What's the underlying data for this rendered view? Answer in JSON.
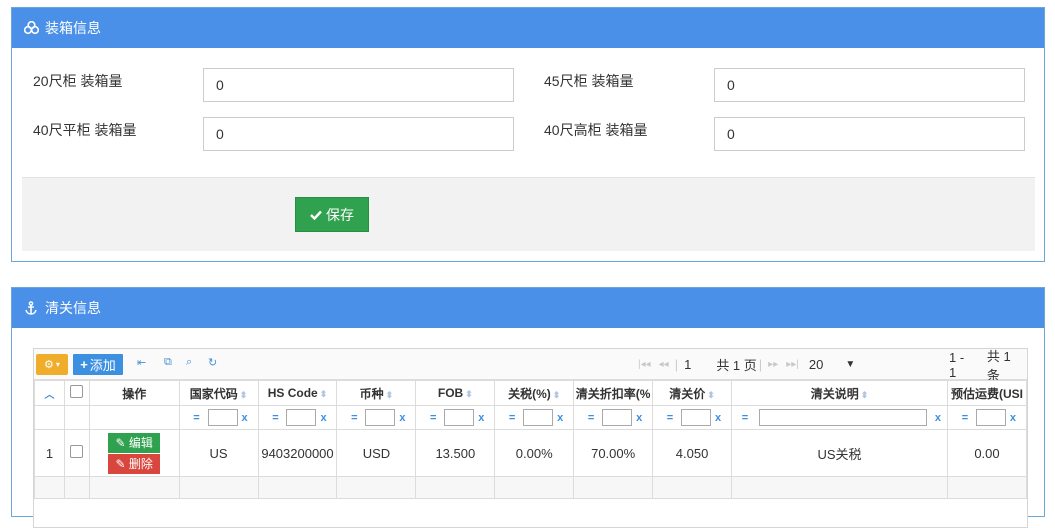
{
  "packing": {
    "title": "装箱信息",
    "icon": "boxes-icon",
    "fields": [
      {
        "label": "20尺柜 装箱量",
        "value": "0"
      },
      {
        "label": "45尺柜 装箱量",
        "value": "0"
      },
      {
        "label": "40尺平柜 装箱量",
        "value": "0"
      },
      {
        "label": "40尺高柜 装箱量",
        "value": "0"
      }
    ],
    "save_label": "保存"
  },
  "customs": {
    "title": "清关信息",
    "icon": "anchor-icon",
    "toolbar": {
      "add_label": "添加",
      "page": "1",
      "total_pages": "共 1 页",
      "page_size": "20",
      "range": "1 - 1",
      "total_rows": "共 1 条"
    },
    "columns": [
      "操作",
      "国家代码",
      "HS Code",
      "币种",
      "FOB",
      "关税(%)",
      "清关折扣率(%",
      "清关价",
      "清关说明",
      "预估运费(USI"
    ],
    "filter_eq": "=",
    "filter_clear": "x",
    "rows": [
      {
        "index": "1",
        "edit_label": "编辑",
        "delete_label": "删除",
        "country": "US",
        "hs_code": "9403200000",
        "currency": "USD",
        "fob": "13.500",
        "duty": "0.00%",
        "discount": "70.00%",
        "price": "4.050",
        "note": "US关税",
        "freight": "0.00"
      }
    ]
  },
  "colors": {
    "header_blue": "#4a90e8",
    "save_green": "#30a14e",
    "delete_red": "#d9463d",
    "gear_orange": "#f0ad2b"
  }
}
